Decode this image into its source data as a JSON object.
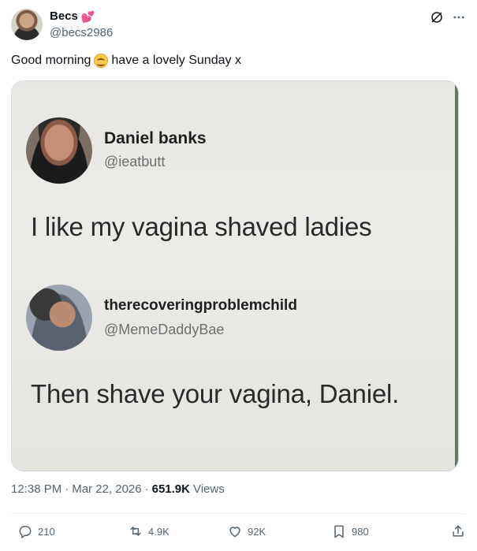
{
  "author": {
    "display_name": "Becs",
    "handle": "@becs2986"
  },
  "tweet": {
    "text_before": "Good morning",
    "text_after": "have a lovely Sunday x"
  },
  "media": {
    "first": {
      "name": "Daniel banks",
      "handle": "@ieatbutt",
      "text": "I like my vagina shaved ladies"
    },
    "second": {
      "name": "therecoveringproblemchild",
      "handle": "@MemeDaddyBae",
      "text": "Then shave your vagina, Daniel."
    }
  },
  "meta": {
    "time": "12:38 PM",
    "date": "Mar 22, 2026",
    "views_count": "651.9K",
    "views_label": "Views"
  },
  "actions": {
    "replies": "210",
    "reposts": "4.9K",
    "likes": "92K",
    "bookmarks": "980"
  },
  "icons": {
    "reply": "reply-icon",
    "repost": "repost-icon",
    "like": "heart-icon",
    "bookmark": "bookmark-icon",
    "share": "share-icon",
    "grok": "grok-icon",
    "more": "more-icon"
  },
  "colors": {
    "text": "#0f1419",
    "secondary": "#536471",
    "heart_emoji": "#e0245e"
  }
}
